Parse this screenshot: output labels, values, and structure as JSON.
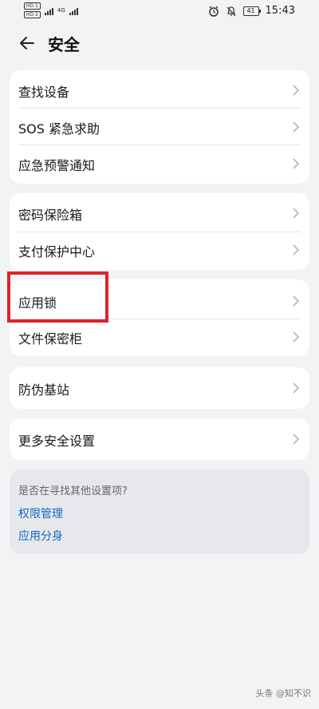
{
  "status_bar": {
    "sim1": "HD 1",
    "sim2": "HD 2",
    "network": "4G",
    "battery": "41",
    "time": "15:43"
  },
  "header": {
    "title": "安全",
    "back_icon": "arrow-left-icon"
  },
  "groups": [
    {
      "items": [
        "查找设备",
        "SOS 紧急求助",
        "应急预警通知"
      ]
    },
    {
      "items": [
        "密码保险箱",
        "支付保护中心"
      ]
    },
    {
      "items": [
        "应用锁",
        "文件保密柜"
      ]
    },
    {
      "items": [
        "防伪基站"
      ]
    },
    {
      "items": [
        "更多安全设置"
      ]
    }
  ],
  "suggestions": {
    "question": "是否在寻找其他设置项?",
    "links": [
      "权限管理",
      "应用分身"
    ]
  },
  "highlight": {
    "target": "应用锁",
    "color": "#d8262b"
  },
  "watermark": "头条 @知不识",
  "colors": {
    "background": "#f1f3f5",
    "card": "#ffffff",
    "link": "#1366c8"
  }
}
